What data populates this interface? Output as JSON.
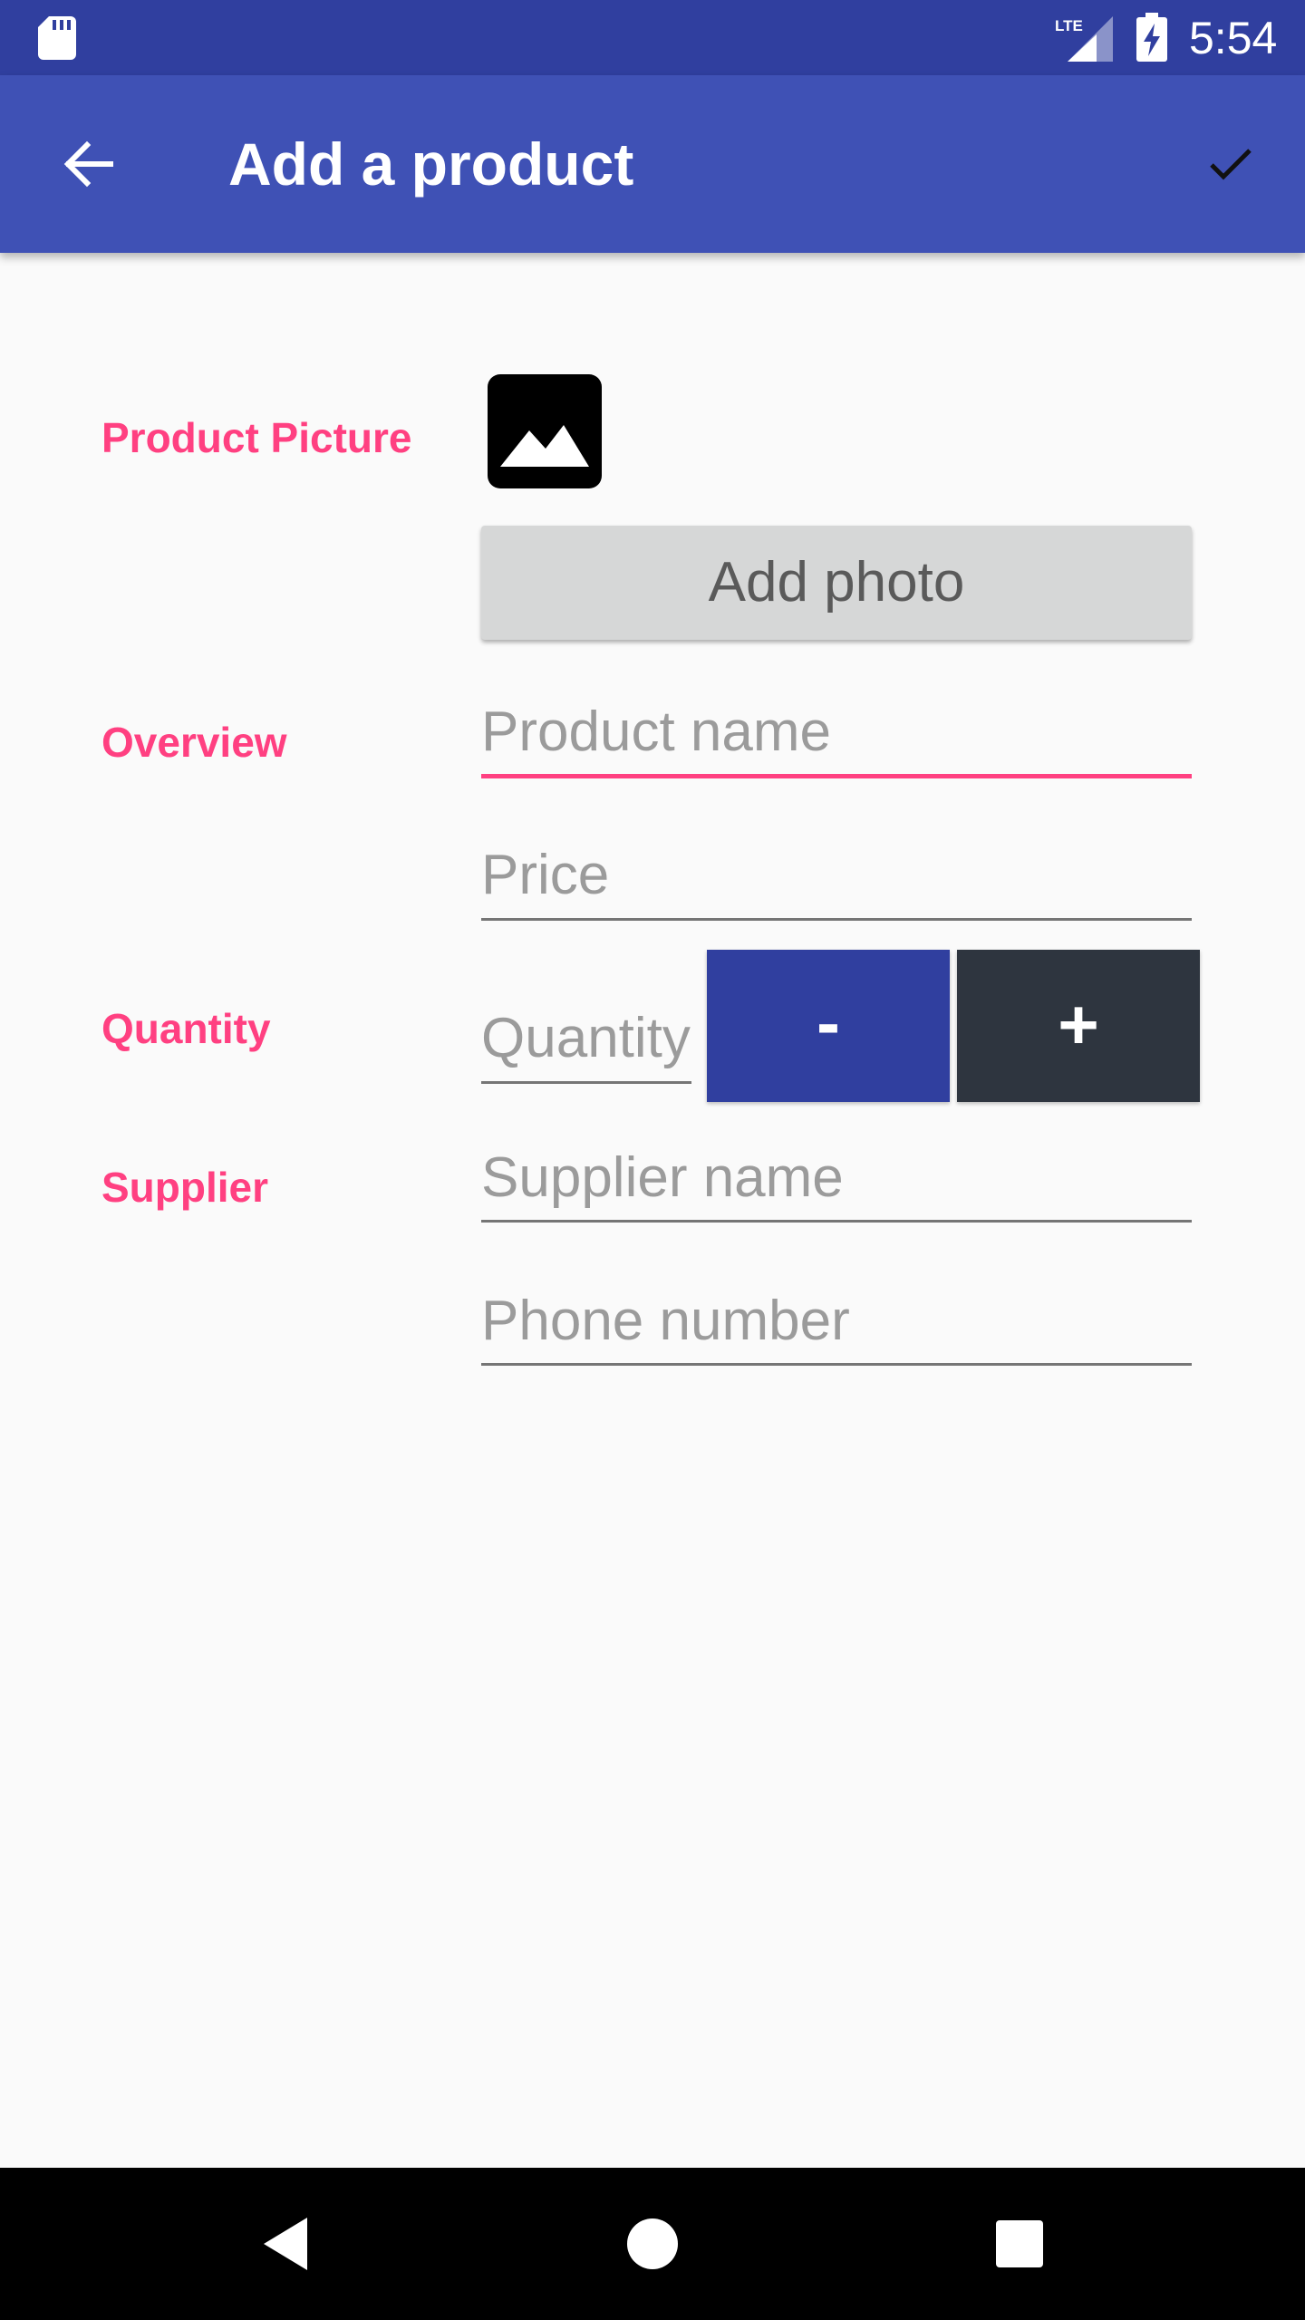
{
  "status_bar": {
    "time": "5:54",
    "network_label": "LTE",
    "icons": [
      "sd-card-icon",
      "lte-signal-icon",
      "battery-charging-icon"
    ]
  },
  "app_bar": {
    "title": "Add a product",
    "back_icon": "arrow-back-icon",
    "save_icon": "check-icon"
  },
  "form": {
    "picture_label": "Product Picture",
    "picture_icon": "image-icon",
    "add_photo_label": "Add photo",
    "overview_label": "Overview",
    "product_name_placeholder": "Product name",
    "price_placeholder": "Price",
    "quantity_label": "Quantity",
    "quantity_placeholder": "Quantity",
    "decrement_label": "-",
    "increment_label": "+",
    "supplier_label": "Supplier",
    "supplier_name_placeholder": "Supplier name",
    "phone_placeholder": "Phone number"
  },
  "nav_bar": {
    "icons": [
      "back-triangle-icon",
      "home-circle-icon",
      "recents-square-icon"
    ]
  },
  "colors": {
    "status_bar": "#303f9f",
    "app_bar": "#3f51b5",
    "accent": "#ff4081",
    "minus_button": "#303f9f",
    "plus_button": "#2e353f",
    "background": "#fafafa"
  }
}
